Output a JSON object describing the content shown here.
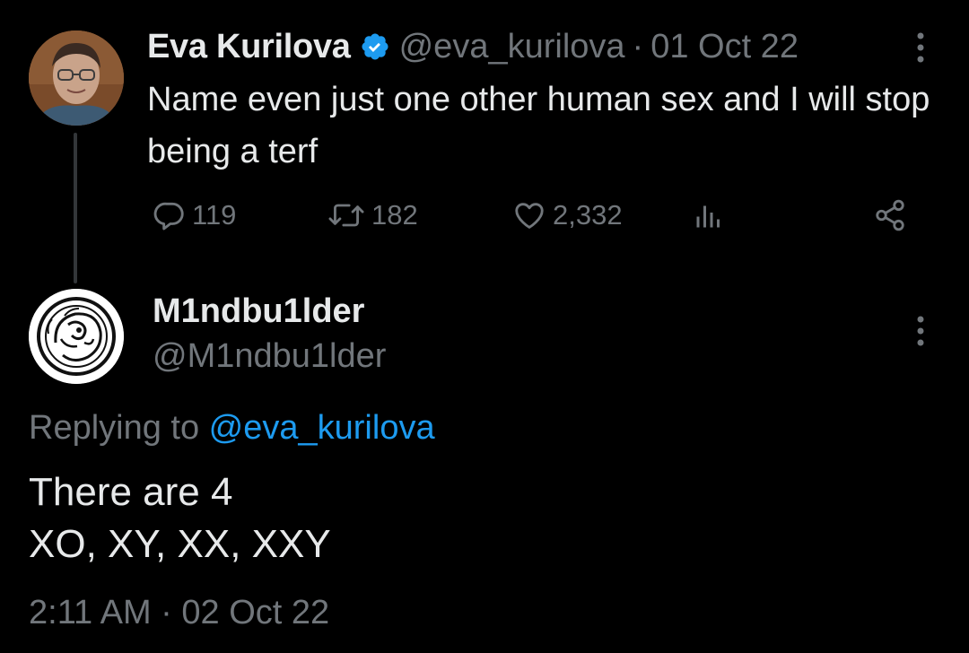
{
  "parent_tweet": {
    "author_name": "Eva Kurilova",
    "handle": "@eva_kurilova",
    "separator": "·",
    "date": "01 Oct 22",
    "text": "Name even just one other human sex and I will stop being a terf",
    "icons": {
      "verified": "verified-badge-icon",
      "more": "more-options-icon"
    },
    "actions": {
      "replies": "119",
      "retweets": "182",
      "likes": "2,332"
    }
  },
  "reply_tweet": {
    "author_name": "M1ndbu1lder",
    "handle": "@M1ndbu1lder",
    "replying_prefix": "Replying to ",
    "replying_to": "@eva_kurilova",
    "text": "There are 4\nXO, XY, XX, XXY",
    "timestamp": "2:11 AM · 02 Oct 22"
  },
  "colors": {
    "background": "#000000",
    "primary_text": "#e7e9ea",
    "secondary_text": "#71767b",
    "accent": "#1d9bf0"
  }
}
